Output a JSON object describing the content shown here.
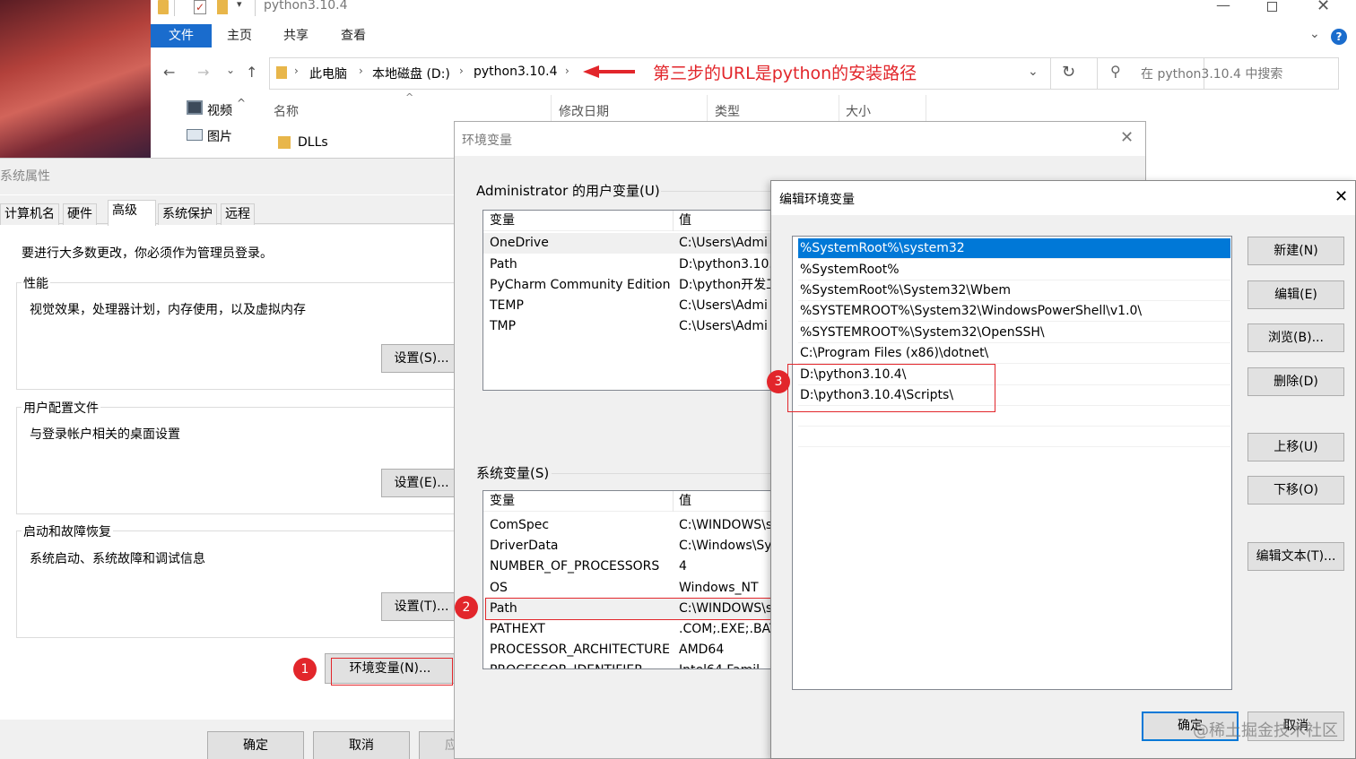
{
  "explorer": {
    "title": "python3.10.4",
    "tabs": [
      "文件",
      "主页",
      "共享",
      "查看"
    ],
    "breadcrumb": [
      "此电脑",
      "本地磁盘 (D:)",
      "python3.10.4"
    ],
    "search_placeholder": "在 python3.10.4 中搜索",
    "nav_items": [
      "视频",
      "图片"
    ],
    "columns": [
      "名称",
      "修改日期",
      "类型",
      "大小"
    ],
    "files": [
      "DLLs"
    ]
  },
  "annotation": {
    "text": "第三步的URL是python的安装路径",
    "badges": [
      "1",
      "2",
      "3"
    ],
    "color": "#e2262b"
  },
  "sysprops": {
    "title": "系统属性",
    "tabs": [
      "计算机名",
      "硬件",
      "高级",
      "系统保护",
      "远程"
    ],
    "admin_note": "要进行大多数更改，你必须作为管理员登录。",
    "groups": [
      {
        "title": "性能",
        "desc": "视觉效果，处理器计划，内存使用，以及虚拟内存",
        "button": "设置(S)..."
      },
      {
        "title": "用户配置文件",
        "desc": "与登录帐户相关的桌面设置",
        "button": "设置(E)..."
      },
      {
        "title": "启动和故障恢复",
        "desc": "系统启动、系统故障和调试信息",
        "button": "设置(T)..."
      }
    ],
    "env_button": "环境变量(N)...",
    "ok": "确定",
    "cancel": "取消",
    "apply_partial": "应"
  },
  "envvars": {
    "title": "环境变量",
    "user_section": "Administrator 的用户变量(U)",
    "system_section": "系统变量(S)",
    "col_var": "变量",
    "col_val": "值",
    "user_vars": [
      {
        "name": "OneDrive",
        "value": "C:\\Users\\Admi"
      },
      {
        "name": "Path",
        "value": "D:\\python3.10."
      },
      {
        "name": "PyCharm Community Edition",
        "value": "D:\\python开发工"
      },
      {
        "name": "TEMP",
        "value": "C:\\Users\\Admi"
      },
      {
        "name": "TMP",
        "value": "C:\\Users\\Admi"
      }
    ],
    "system_vars": [
      {
        "name": "ComSpec",
        "value": "C:\\WINDOWS\\s"
      },
      {
        "name": "DriverData",
        "value": "C:\\Windows\\Sy"
      },
      {
        "name": "NUMBER_OF_PROCESSORS",
        "value": "4"
      },
      {
        "name": "OS",
        "value": "Windows_NT"
      },
      {
        "name": "Path",
        "value": "C:\\WINDOWS\\s"
      },
      {
        "name": "PATHEXT",
        "value": ".COM;.EXE;.BAT"
      },
      {
        "name": "PROCESSOR_ARCHITECTURE",
        "value": "AMD64"
      },
      {
        "name": "PROCESSOR_IDENTIFIER",
        "value": "Intel64 Famil"
      }
    ]
  },
  "editenv": {
    "title": "编辑环境变量",
    "entries": [
      "%SystemRoot%\\system32",
      "%SystemRoot%",
      "%SystemRoot%\\System32\\Wbem",
      "%SYSTEMROOT%\\System32\\WindowsPowerShell\\v1.0\\",
      "%SYSTEMROOT%\\System32\\OpenSSH\\",
      "C:\\Program Files (x86)\\dotnet\\",
      "D:\\python3.10.4\\",
      "D:\\python3.10.4\\Scripts\\"
    ],
    "buttons": {
      "new": "新建(N)",
      "edit": "编辑(E)",
      "browse": "浏览(B)...",
      "delete": "删除(D)",
      "up": "上移(U)",
      "down": "下移(O)",
      "edit_text": "编辑文本(T)..."
    },
    "ok": "确定",
    "cancel": "取消"
  },
  "watermark": "@稀土掘金技术社区",
  "icons": [
    "folder-icon",
    "checkbox-icon",
    "chevron-down-icon",
    "minimize-icon",
    "maximize-icon",
    "close-icon",
    "help-icon",
    "back-arrow-icon",
    "forward-arrow-icon",
    "up-arrow-icon",
    "refresh-icon",
    "search-icon",
    "video-icon",
    "picture-icon",
    "red-arrow-icon"
  ]
}
